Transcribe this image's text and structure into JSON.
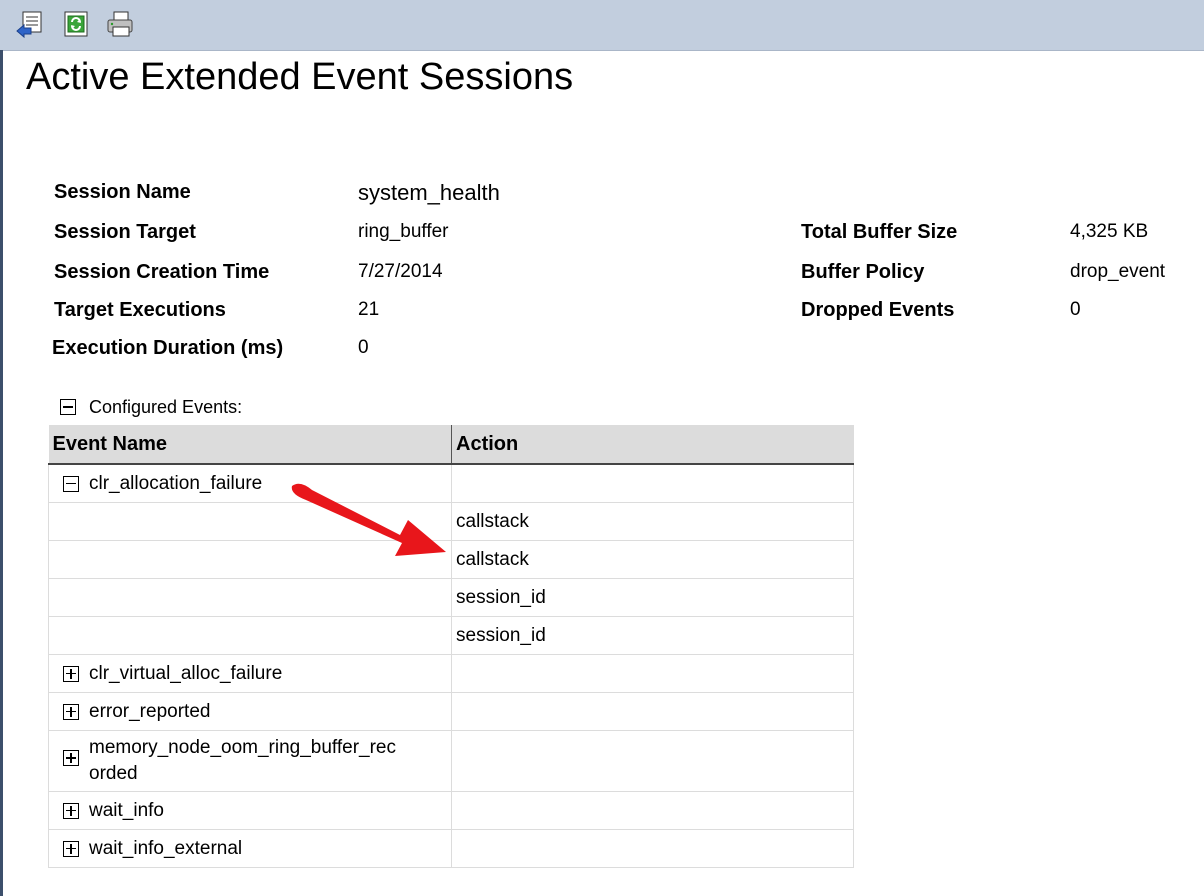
{
  "toolbar": {
    "buttons": [
      {
        "name": "export-icon"
      },
      {
        "name": "refresh-icon"
      },
      {
        "name": "print-icon"
      }
    ]
  },
  "report": {
    "title": "Active Extended Event Sessions",
    "left_fields": [
      {
        "label": "Session Name",
        "value": "system_health"
      },
      {
        "label": "Session Target",
        "value": "ring_buffer"
      },
      {
        "label": "Session Creation Time",
        "value": "7/27/2014"
      },
      {
        "label": "Target Executions",
        "value": "21"
      },
      {
        "label": "Execution Duration (ms)",
        "value": "0"
      }
    ],
    "right_fields": [
      {
        "label": "Total Buffer Size",
        "value": "4,325 KB"
      },
      {
        "label": "Buffer Policy",
        "value": "drop_event"
      },
      {
        "label": "Dropped Events",
        "value": "0"
      }
    ]
  },
  "events": {
    "section_label": "Configured Events:",
    "columns": [
      "Event Name",
      "Action"
    ],
    "rows": [
      {
        "event": "clr_allocation_failure",
        "toggle": "collapse",
        "action": ""
      },
      {
        "event": "",
        "action": "callstack"
      },
      {
        "event": "",
        "action": "callstack"
      },
      {
        "event": "",
        "action": "session_id"
      },
      {
        "event": "",
        "action": "session_id"
      },
      {
        "event": "clr_virtual_alloc_failure",
        "toggle": "expand",
        "action": ""
      },
      {
        "event": "error_reported",
        "toggle": "expand",
        "action": ""
      },
      {
        "event": "memory_node_oom_ring_buffer_rec",
        "event_cont": "orded",
        "toggle": "expand",
        "action": ""
      },
      {
        "event": "wait_info",
        "toggle": "expand",
        "action": ""
      },
      {
        "event": "wait_info_external",
        "toggle": "expand",
        "action": ""
      }
    ]
  },
  "annotation": {
    "arrow_color": "#e8161b"
  }
}
